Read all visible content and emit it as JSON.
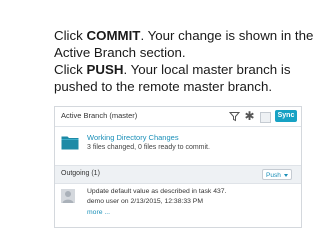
{
  "instructions": {
    "p1_pre": "Click ",
    "p1_bold": "COMMIT",
    "p1_post": ". Your change is shown in the Active Branch section.",
    "p2_pre": "Click ",
    "p2_bold": "PUSH",
    "p2_post": ". Your local master branch is pushed to the remote master branch."
  },
  "panel": {
    "title": "Active Branch (master)",
    "sync_label": "Sync",
    "icons": [
      "filter-icon",
      "asterisk-icon",
      "square-icon"
    ],
    "working_dir": {
      "title": "Working Directory Changes",
      "subtitle": "3 files changed, 0 files ready to commit."
    },
    "outgoing": {
      "label": "Outgoing (1)",
      "push_label": "Push"
    },
    "commit": {
      "message": "Update default value as described in task 437.",
      "author_line": "demo user on 2/13/2015, 12:38:33 PM",
      "more_label": "more ..."
    }
  },
  "colors": {
    "accent": "#17a2c4",
    "link": "#1a8fb8",
    "folder": "#1d8aa6"
  }
}
